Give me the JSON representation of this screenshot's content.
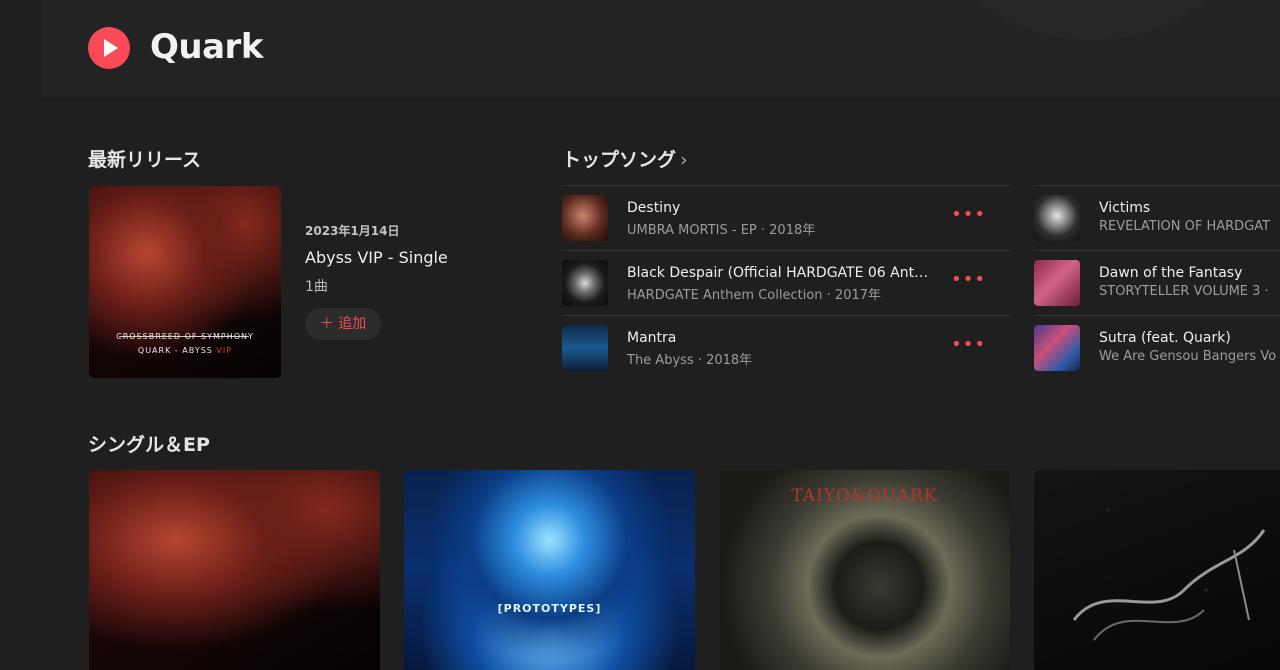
{
  "header": {
    "artist": "Quark",
    "logo_icon": "play-icon"
  },
  "latest_release": {
    "section_title": "最新リリース",
    "date": "2023年1月14日",
    "title": "Abyss VIP - Single",
    "track_count": "1曲",
    "add_label": "＋ 追加",
    "cover": {
      "line1": "CROSSBREED OF SYMPHONY",
      "line2": "QUARK - ABYSS",
      "line2_accent": "VIP"
    }
  },
  "top_songs": {
    "section_title": "トップソング",
    "more_glyph": "•••",
    "songs": [
      {
        "title": "Destiny",
        "subtitle": "UMBRA MORTIS - EP · 2018年"
      },
      {
        "title": "Black Despair (Official HARDGATE 06 Ant…",
        "subtitle": "HARDGATE Anthem Collection · 2017年"
      },
      {
        "title": "Mantra",
        "subtitle": "The Abyss · 2018年"
      },
      {
        "title": "Victims",
        "subtitle": "REVELATION OF HARDGAT"
      },
      {
        "title": "Dawn of the Fantasy",
        "subtitle": "STORYTELLER VOLUME 3 ·"
      },
      {
        "title": "Sutra (feat. Quark)",
        "subtitle": "We Are Gensou Bangers Vo"
      }
    ]
  },
  "singles": {
    "section_title": "シングル＆EP",
    "covers": [
      {
        "text": ""
      },
      {
        "text": "[PROTOTYPES]"
      },
      {
        "text": "TAIYO&QUARK"
      },
      {
        "text": ""
      }
    ]
  },
  "colors": {
    "accent": "#fa4a58",
    "background": "#1f1f1f"
  }
}
